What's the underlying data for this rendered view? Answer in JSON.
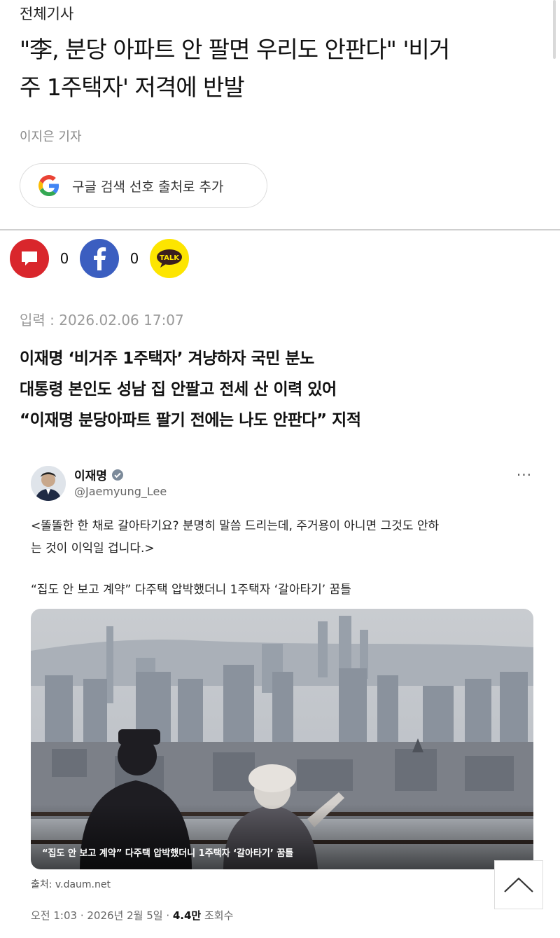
{
  "article": {
    "category": "전체기사",
    "headline_line1": "\"李, 분당 아파트 안 팔면 우리도 안판다\" '비거",
    "headline_line2": "주 1주택자' 저격에 반발",
    "reporter": "이지은 기자",
    "google_button_label": "구글 검색 선호 출처로 추가",
    "comment_count": "0",
    "facebook_count": "0",
    "talk_label": "TALK",
    "date_label": "입력 : 2026.02.06 17:07",
    "summary": [
      "이재명 ‘비거주 1주택자’ 겨냥하자 국민 분노",
      "대통령 본인도 성남 집 안팔고 전세 산 이력 있어",
      "“이재명 분당아파트 팔기 전에는 나도 안판다” 지적"
    ]
  },
  "tweet": {
    "name": "이재명",
    "handle": "@Jaemyung_Lee",
    "more": "···",
    "body_line1": "<똘똘한 한 채로 갈아타기요? 분명히 말씀 드리는데, 주거용이 아니면 그것도 안하",
    "body_line2": "는 것이 이익일 겁니다.>",
    "link_title": "“집도 안 보고 계약” 다주택 압박했더니 1주택자 ‘갈아타기’ 꿈틀",
    "photo_caption": "“집도 안 보고 계약” 다주택 압박했더니 1주택자 ‘갈아타기’ 꿈틀",
    "source": "출처: v.daum.net",
    "meta_time": "오전 1:03 · 2026년 2월 5일 · ",
    "meta_views": "4.4만",
    "meta_views_suffix": " 조회수"
  },
  "colors": {
    "comment": "#d9262c",
    "facebook": "#3b5ec0",
    "kakao": "#fde500",
    "verified": "#7c8a9a"
  }
}
